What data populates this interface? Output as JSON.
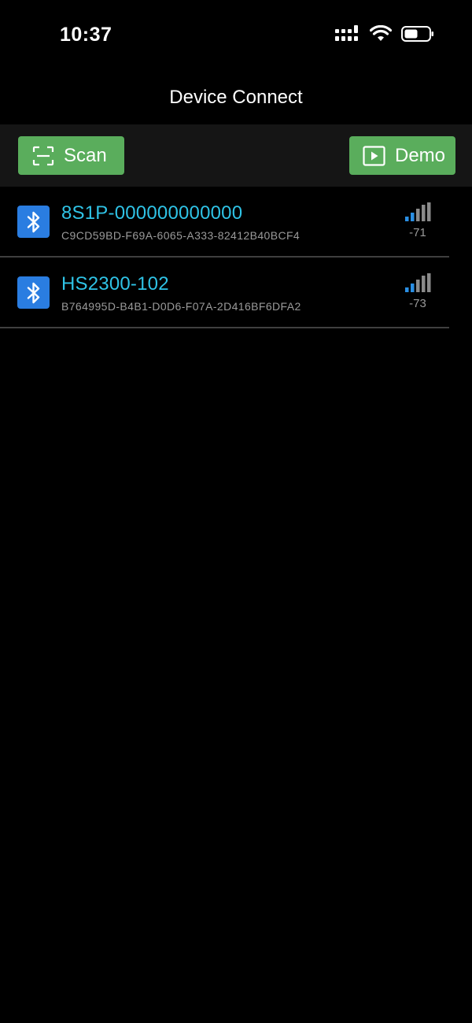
{
  "status_bar": {
    "time": "10:37",
    "icons": [
      "cellular-signal-icon",
      "wifi-icon",
      "battery-icon"
    ]
  },
  "nav": {
    "title": "Device Connect"
  },
  "toolbar": {
    "scan_label": "Scan",
    "scan_icon": "scan-frame-icon",
    "demo_label": "Demo",
    "demo_icon": "play-icon"
  },
  "colors": {
    "background": "#000000",
    "toolbar_bg": "#151515",
    "button_green": "#5aad5c",
    "device_name_cyan": "#2fc3e6",
    "bluetooth_blue": "#2a7de1",
    "secondary_text": "#9a9a9a",
    "divider": "#3f3f3f"
  },
  "devices": [
    {
      "name": "8S1P-000000000000",
      "uuid": "C9CD59BD-F69A-6065-A333-82412B40BCF4",
      "rssi": "-71",
      "icon": "bluetooth-icon",
      "signal_bars_active": 2,
      "signal_bars_total": 4
    },
    {
      "name": "HS2300-102",
      "uuid": "B764995D-B4B1-D0D6-F07A-2D416BF6DFA2",
      "rssi": "-73",
      "icon": "bluetooth-icon",
      "signal_bars_active": 2,
      "signal_bars_total": 4
    }
  ]
}
